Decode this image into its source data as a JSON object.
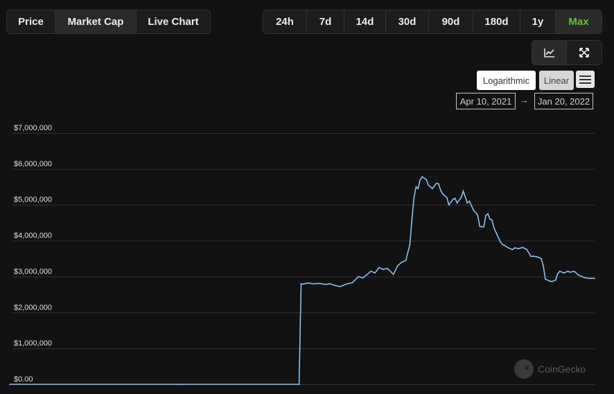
{
  "tabs": [
    {
      "label": "Price"
    },
    {
      "label": "Market Cap"
    },
    {
      "label": "Live Chart"
    }
  ],
  "ranges": [
    {
      "label": "24h"
    },
    {
      "label": "7d"
    },
    {
      "label": "14d"
    },
    {
      "label": "30d"
    },
    {
      "label": "90d"
    },
    {
      "label": "180d"
    },
    {
      "label": "1y"
    },
    {
      "label": "Max"
    }
  ],
  "tools": {
    "line_icon": "line-chart-icon",
    "expand_icon": "fullscreen-icon"
  },
  "scale": {
    "logarithmic": "Logarithmic",
    "linear": "Linear"
  },
  "date_range": {
    "from": "Apr 10, 2021",
    "arrow": "→",
    "to": "Jan 20, 2022"
  },
  "watermark": "CoinGecko",
  "colors": {
    "line": "#8fbff0",
    "active_range": "#6cba3f",
    "background": "#121212"
  },
  "chart_data": {
    "type": "line",
    "title": "",
    "xlabel": "",
    "ylabel": "",
    "ylim": [
      0,
      7000000
    ],
    "yticks": [
      0,
      1000000,
      2000000,
      3000000,
      4000000,
      5000000,
      6000000,
      7000000
    ],
    "ytick_labels": [
      "$0.00",
      "$1,000,000",
      "$2,000,000",
      "$3,000,000",
      "$4,000,000",
      "$5,000,000",
      "$6,000,000",
      "$7,000,000"
    ],
    "xlim": [
      "2021-04-10",
      "2022-01-20"
    ],
    "grid": true,
    "legend": "none",
    "x": [
      "2021-04-10",
      "2021-07-01",
      "2021-08-29",
      "2021-08-30",
      "2021-08-31",
      "2021-09-02",
      "2021-09-05",
      "2021-09-08",
      "2021-09-11",
      "2021-09-13",
      "2021-09-15",
      "2021-09-18",
      "2021-09-21",
      "2021-09-24",
      "2021-09-27",
      "2021-09-29",
      "2021-10-01",
      "2021-10-03",
      "2021-10-05",
      "2021-10-07",
      "2021-10-09",
      "2021-10-11",
      "2021-10-14",
      "2021-10-16",
      "2021-10-18",
      "2021-10-20",
      "2021-10-22",
      "2021-10-23",
      "2021-10-24",
      "2021-10-25",
      "2021-10-26",
      "2021-10-27",
      "2021-10-28",
      "2021-10-30",
      "2021-10-31",
      "2021-11-02",
      "2021-11-04",
      "2021-11-05",
      "2021-11-06",
      "2021-11-07",
      "2021-11-09",
      "2021-11-10",
      "2021-11-12",
      "2021-11-13",
      "2021-11-14",
      "2021-11-16",
      "2021-11-17",
      "2021-11-19",
      "2021-11-20",
      "2021-11-22",
      "2021-11-24",
      "2021-11-25",
      "2021-11-27",
      "2021-11-28",
      "2021-11-29",
      "2021-11-30",
      "2021-12-01",
      "2021-12-02",
      "2021-12-04",
      "2021-12-05",
      "2021-12-06",
      "2021-12-07",
      "2021-12-09",
      "2021-12-11",
      "2021-12-12",
      "2021-12-14",
      "2021-12-16",
      "2021-12-18",
      "2021-12-20",
      "2021-12-21",
      "2021-12-23",
      "2021-12-25",
      "2021-12-26",
      "2021-12-27",
      "2021-12-29",
      "2021-12-30",
      "2022-01-01",
      "2022-01-02",
      "2022-01-03",
      "2022-01-05",
      "2022-01-07",
      "2022-01-08",
      "2022-01-10",
      "2022-01-12",
      "2022-01-14",
      "2022-01-16",
      "2022-01-18",
      "2022-01-20"
    ],
    "series": [
      {
        "values": [
          0,
          0,
          0,
          2800000,
          2790000,
          2820000,
          2800000,
          2810000,
          2780000,
          2800000,
          2760000,
          2720000,
          2790000,
          2830000,
          3000000,
          2960000,
          3050000,
          3150000,
          3100000,
          3250000,
          3200000,
          3230000,
          3060000,
          3300000,
          3400000,
          3450000,
          3900000,
          4600000,
          5200000,
          5500000,
          5450000,
          5700000,
          5780000,
          5700000,
          5550000,
          5450000,
          5600000,
          5580000,
          5400000,
          5300000,
          5200000,
          5000000,
          5150000,
          5180000,
          5050000,
          5200000,
          5380000,
          5050000,
          5100000,
          4850000,
          4720000,
          4400000,
          4380000,
          4700000,
          4750000,
          4600000,
          4580000,
          4350000,
          4100000,
          3980000,
          3900000,
          3870000,
          3800000,
          3750000,
          3800000,
          3780000,
          3810000,
          3750000,
          3560000,
          3570000,
          3550000,
          3500000,
          3300000,
          2930000,
          2880000,
          2860000,
          2900000,
          3080000,
          3150000,
          3100000,
          3150000,
          3120000,
          3150000,
          3050000,
          2990000,
          2960000,
          2950000,
          2950000
        ]
      }
    ]
  }
}
